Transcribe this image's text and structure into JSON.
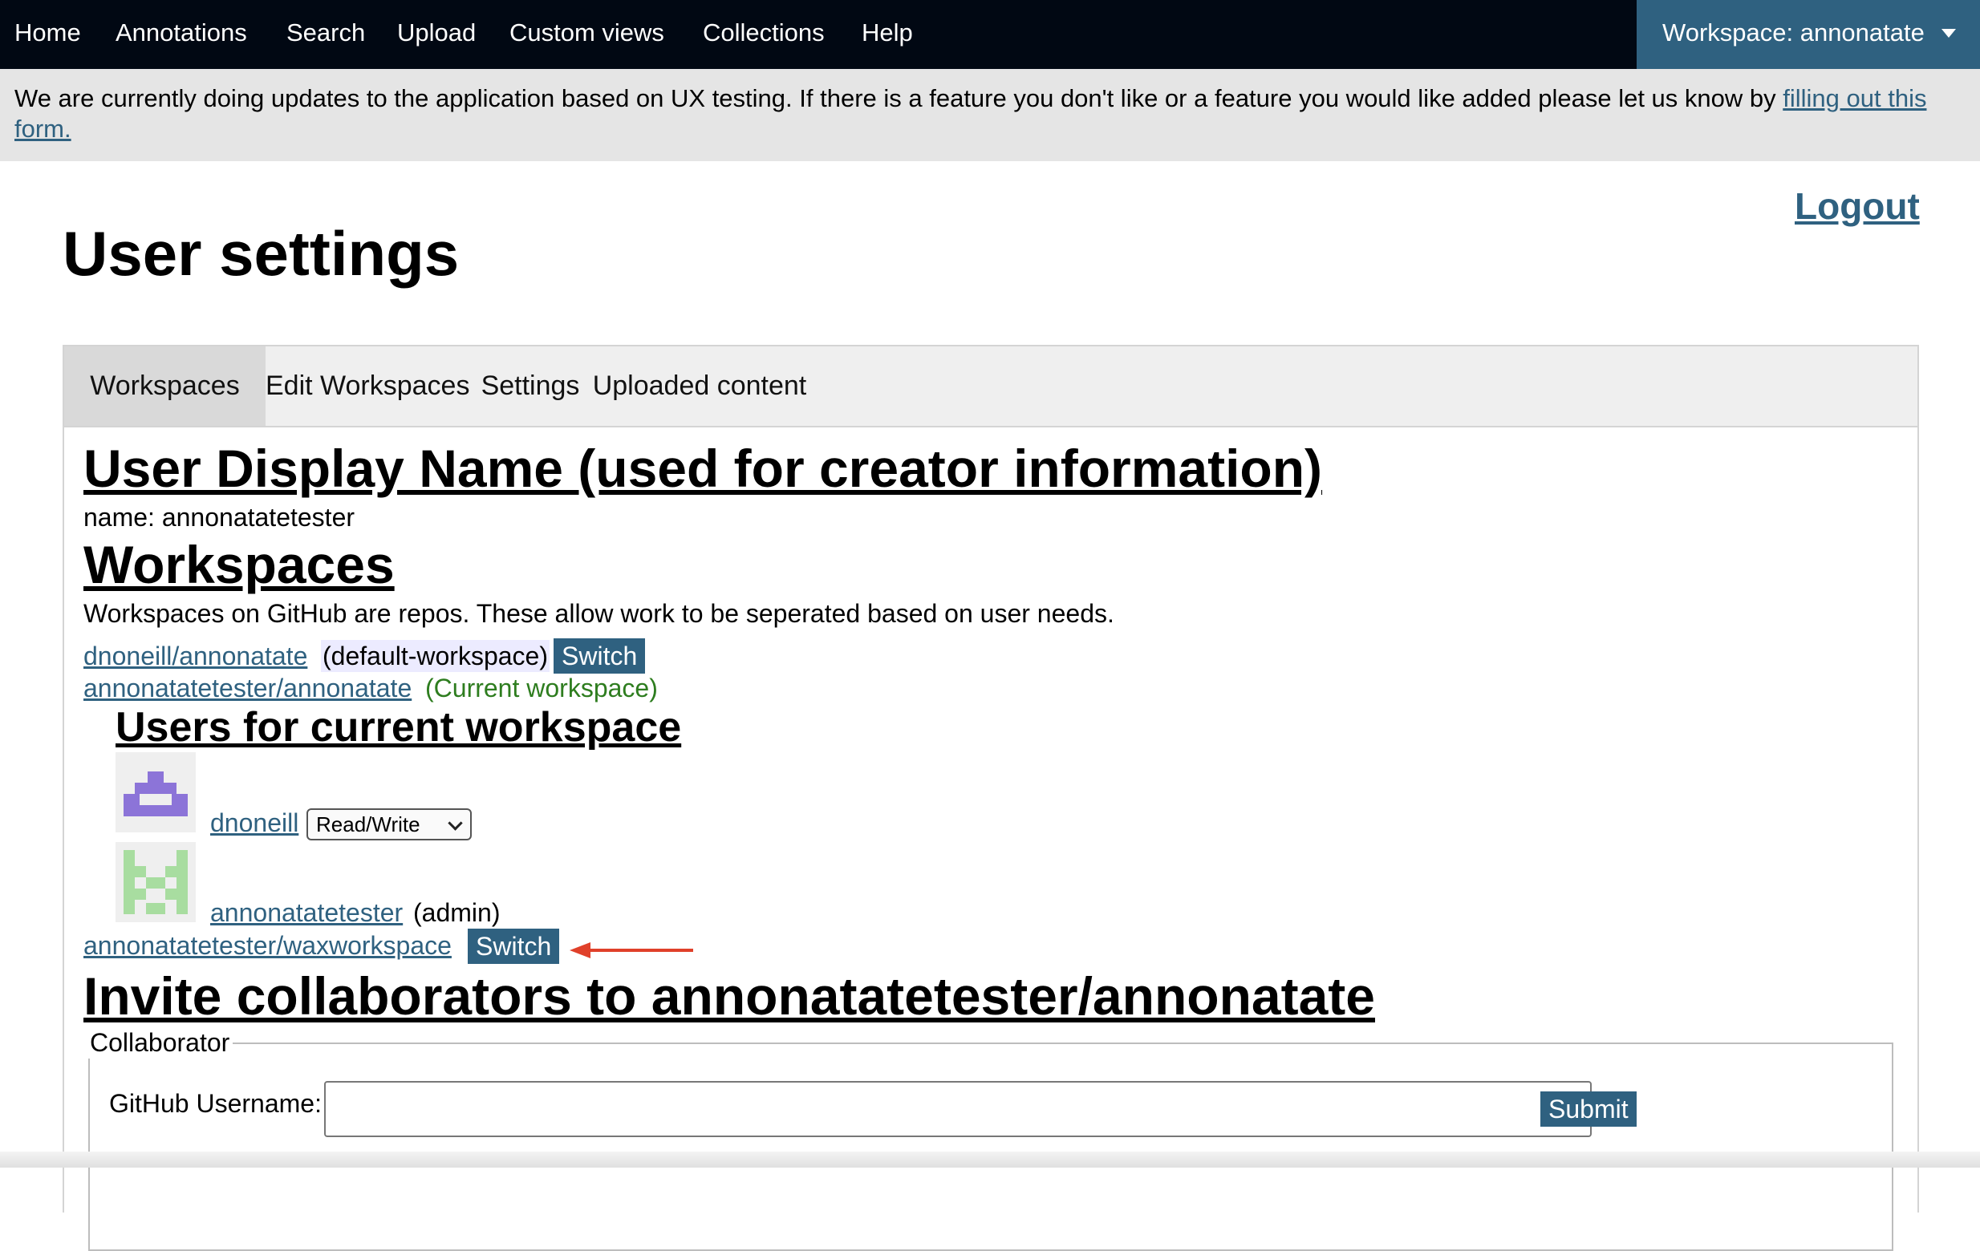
{
  "nav": {
    "items": [
      "Home",
      "Annotations",
      "Search",
      "Upload",
      "Custom views",
      "Collections",
      "Help"
    ],
    "workspace_label": "Workspace: annonatate"
  },
  "banner": {
    "text": "We are currently doing updates to the application based on UX testing. If there is a feature you don't like or a feature you would like added please let us know by ",
    "link_text": "filling out this form."
  },
  "logout_label": "Logout",
  "page_title": "User settings",
  "tabs": [
    "Workspaces",
    "Edit Workspaces",
    "Settings",
    "Uploaded content"
  ],
  "active_tab": "Workspaces",
  "display_name": {
    "heading": "User Display Name (used for creator information)",
    "text": "name: annonatatetester"
  },
  "workspaces": {
    "heading": "Workspaces",
    "description": "Workspaces on GitHub are repos. These allow work to be seperated based on user needs.",
    "list": [
      {
        "name": "dnoneill/annonatate",
        "tag": "(default-workspace)",
        "action": "Switch"
      },
      {
        "name": "annonatatetester/annonatate",
        "tag": "(Current workspace)"
      },
      {
        "name": "annonatatetester/waxworkspace",
        "action": "Switch"
      }
    ],
    "users_heading": "Users for current workspace",
    "users": [
      {
        "name": "dnoneill",
        "role": "Read/Write",
        "avatar_color": "#8c74d8"
      },
      {
        "name": "annonatatetester",
        "role_label": "(admin)",
        "avatar_color": "#a8dda0"
      }
    ]
  },
  "invite": {
    "heading": "Invite collaborators to annonatatetester/annonatate",
    "legend": "Collaborator",
    "field_label": "GitHub Username:",
    "field_value": "",
    "submit_label": "Submit"
  },
  "colors": {
    "nav_bg": "#010813",
    "accent": "#2f6180",
    "banner_bg": "#e5e5e5",
    "current_workspace": "#2e7d1f",
    "annotation_arrow": "#e0402a"
  },
  "annotation": {
    "type": "arrow",
    "points_to": "annonatatetester/waxworkspace Switch button"
  }
}
